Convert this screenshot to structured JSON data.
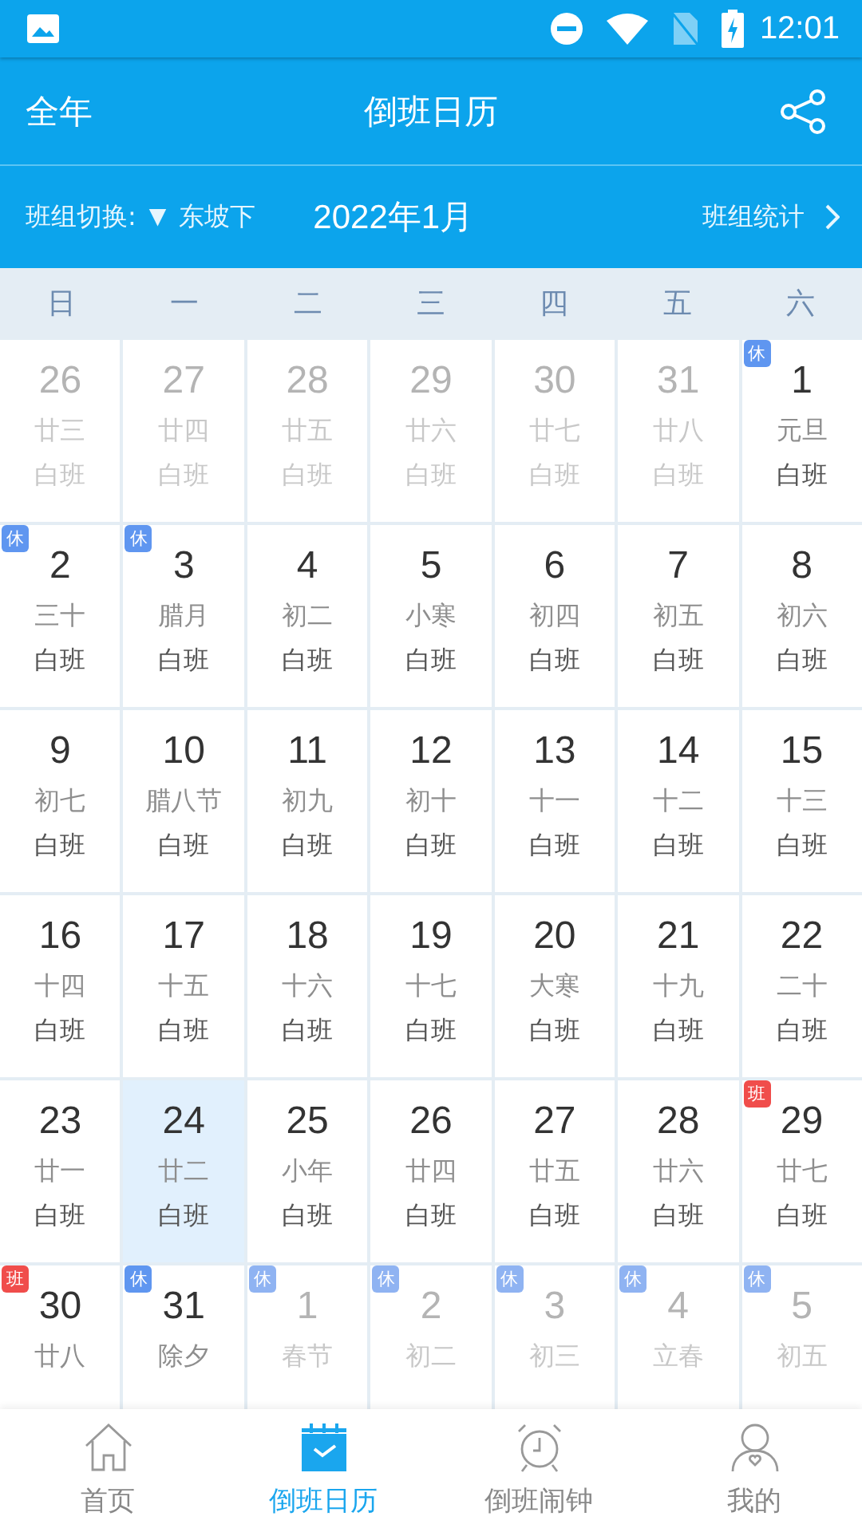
{
  "status_bar": {
    "time": "12:01"
  },
  "header": {
    "left": "全年",
    "title": "倒班日历"
  },
  "toolbar": {
    "group_label": "班组切换:",
    "caret": "▼",
    "group": "东坡下",
    "month": "2022年1月",
    "stats": "班组统计"
  },
  "weekdays": [
    "日",
    "一",
    "二",
    "三",
    "四",
    "五",
    "六"
  ],
  "days": [
    {
      "day": "26",
      "lunar": "廿三",
      "shift": "白班",
      "muted": true,
      "selected": false
    },
    {
      "day": "27",
      "lunar": "廿四",
      "shift": "白班",
      "muted": true,
      "selected": false
    },
    {
      "day": "28",
      "lunar": "廿五",
      "shift": "白班",
      "muted": true,
      "selected": false
    },
    {
      "day": "29",
      "lunar": "廿六",
      "shift": "白班",
      "muted": true,
      "selected": false
    },
    {
      "day": "30",
      "lunar": "廿七",
      "shift": "白班",
      "muted": true,
      "selected": false
    },
    {
      "day": "31",
      "lunar": "廿八",
      "shift": "白班",
      "muted": true,
      "selected": false
    },
    {
      "day": "1",
      "lunar": "元旦",
      "shift": "白班",
      "muted": false,
      "selected": false,
      "badge": {
        "label": "休",
        "kind": "rest"
      }
    },
    {
      "day": "2",
      "lunar": "三十",
      "shift": "白班",
      "muted": false,
      "selected": false,
      "badge": {
        "label": "休",
        "kind": "rest"
      }
    },
    {
      "day": "3",
      "lunar": "腊月",
      "shift": "白班",
      "muted": false,
      "selected": false,
      "badge": {
        "label": "休",
        "kind": "rest"
      }
    },
    {
      "day": "4",
      "lunar": "初二",
      "shift": "白班",
      "muted": false,
      "selected": false
    },
    {
      "day": "5",
      "lunar": "小寒",
      "shift": "白班",
      "muted": false,
      "selected": false
    },
    {
      "day": "6",
      "lunar": "初四",
      "shift": "白班",
      "muted": false,
      "selected": false
    },
    {
      "day": "7",
      "lunar": "初五",
      "shift": "白班",
      "muted": false,
      "selected": false
    },
    {
      "day": "8",
      "lunar": "初六",
      "shift": "白班",
      "muted": false,
      "selected": false
    },
    {
      "day": "9",
      "lunar": "初七",
      "shift": "白班",
      "muted": false,
      "selected": false
    },
    {
      "day": "10",
      "lunar": "腊八节",
      "shift": "白班",
      "muted": false,
      "selected": false
    },
    {
      "day": "11",
      "lunar": "初九",
      "shift": "白班",
      "muted": false,
      "selected": false
    },
    {
      "day": "12",
      "lunar": "初十",
      "shift": "白班",
      "muted": false,
      "selected": false
    },
    {
      "day": "13",
      "lunar": "十一",
      "shift": "白班",
      "muted": false,
      "selected": false
    },
    {
      "day": "14",
      "lunar": "十二",
      "shift": "白班",
      "muted": false,
      "selected": false
    },
    {
      "day": "15",
      "lunar": "十三",
      "shift": "白班",
      "muted": false,
      "selected": false
    },
    {
      "day": "16",
      "lunar": "十四",
      "shift": "白班",
      "muted": false,
      "selected": false
    },
    {
      "day": "17",
      "lunar": "十五",
      "shift": "白班",
      "muted": false,
      "selected": false
    },
    {
      "day": "18",
      "lunar": "十六",
      "shift": "白班",
      "muted": false,
      "selected": false
    },
    {
      "day": "19",
      "lunar": "十七",
      "shift": "白班",
      "muted": false,
      "selected": false
    },
    {
      "day": "20",
      "lunar": "大寒",
      "shift": "白班",
      "muted": false,
      "selected": false
    },
    {
      "day": "21",
      "lunar": "十九",
      "shift": "白班",
      "muted": false,
      "selected": false
    },
    {
      "day": "22",
      "lunar": "二十",
      "shift": "白班",
      "muted": false,
      "selected": false
    },
    {
      "day": "23",
      "lunar": "廿一",
      "shift": "白班",
      "muted": false,
      "selected": false
    },
    {
      "day": "24",
      "lunar": "廿二",
      "shift": "白班",
      "muted": false,
      "selected": true
    },
    {
      "day": "25",
      "lunar": "小年",
      "shift": "白班",
      "muted": false,
      "selected": false
    },
    {
      "day": "26",
      "lunar": "廿四",
      "shift": "白班",
      "muted": false,
      "selected": false
    },
    {
      "day": "27",
      "lunar": "廿五",
      "shift": "白班",
      "muted": false,
      "selected": false
    },
    {
      "day": "28",
      "lunar": "廿六",
      "shift": "白班",
      "muted": false,
      "selected": false
    },
    {
      "day": "29",
      "lunar": "廿七",
      "shift": "白班",
      "muted": false,
      "selected": false,
      "badge": {
        "label": "班",
        "kind": "work"
      }
    },
    {
      "day": "30",
      "lunar": "廿八",
      "muted": false,
      "selected": false,
      "badge": {
        "label": "班",
        "kind": "work"
      }
    },
    {
      "day": "31",
      "lunar": "除夕",
      "muted": false,
      "selected": false,
      "badge": {
        "label": "休",
        "kind": "rest"
      }
    },
    {
      "day": "1",
      "lunar": "春节",
      "muted": true,
      "selected": false,
      "badge": {
        "label": "休",
        "kind": "rest"
      }
    },
    {
      "day": "2",
      "lunar": "初二",
      "muted": true,
      "selected": false,
      "badge": {
        "label": "休",
        "kind": "rest"
      }
    },
    {
      "day": "3",
      "lunar": "初三",
      "muted": true,
      "selected": false,
      "badge": {
        "label": "休",
        "kind": "rest"
      }
    },
    {
      "day": "4",
      "lunar": "立春",
      "muted": true,
      "selected": false,
      "badge": {
        "label": "休",
        "kind": "rest"
      }
    },
    {
      "day": "5",
      "lunar": "初五",
      "muted": true,
      "selected": false,
      "badge": {
        "label": "休",
        "kind": "rest"
      }
    }
  ],
  "nav": [
    {
      "label": "首页",
      "selected": false
    },
    {
      "label": "倒班日历",
      "selected": true
    },
    {
      "label": "倒班闹钟",
      "selected": false
    },
    {
      "label": "我的",
      "selected": false
    }
  ]
}
